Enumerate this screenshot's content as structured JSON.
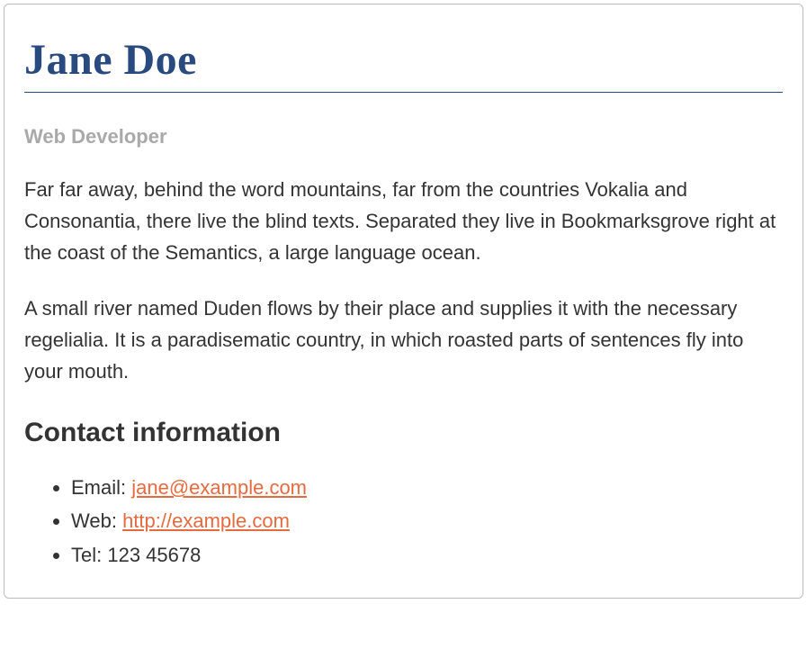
{
  "name": "Jane Doe",
  "subtitle": "Web Developer",
  "paragraphs": [
    "Far far away, behind the word mountains, far from the countries Vokalia and Consonantia, there live the blind texts. Separated they live in Bookmarksgrove right at the coast of the Semantics, a large language ocean.",
    "A small river named Duden flows by their place and supplies it with the necessary regelialia. It is a paradisematic country, in which roasted parts of sentences fly into your mouth."
  ],
  "contact": {
    "heading": "Contact information",
    "items": [
      {
        "label": "Email: ",
        "link_text": "jane@example.com",
        "is_link": true
      },
      {
        "label": "Web: ",
        "link_text": "http://example.com",
        "is_link": true
      },
      {
        "label": "Tel: 123 45678",
        "link_text": "",
        "is_link": false
      }
    ]
  }
}
